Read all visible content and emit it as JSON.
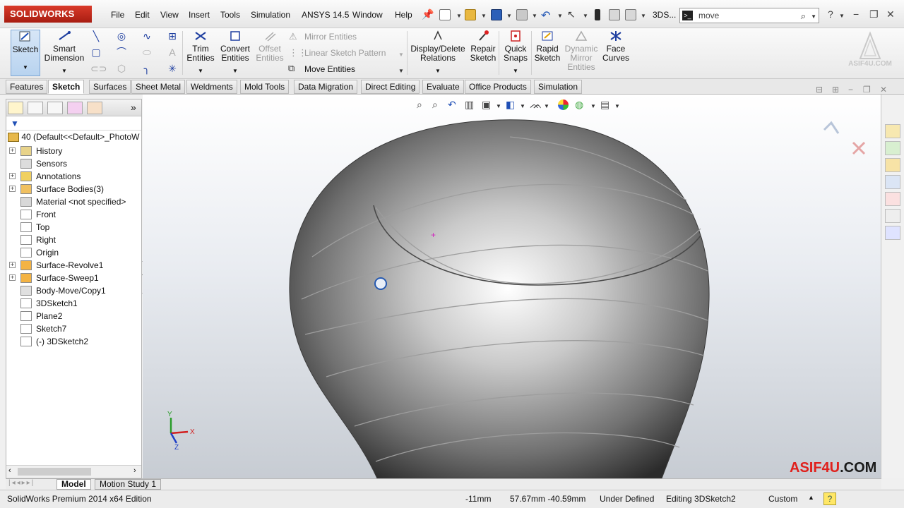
{
  "app": {
    "logo_text": "SOLIDWORKS",
    "menus": [
      "File",
      "Edit",
      "View",
      "Insert",
      "Tools",
      "Simulation",
      "ANSYS 14.5",
      "Window",
      "Help"
    ],
    "doc_name": "3DS...",
    "search": {
      "value": "move"
    }
  },
  "ribbon": {
    "sketch": "Sketch",
    "smart_dimension": [
      "Smart",
      "Dimension"
    ],
    "trim_entities": [
      "Trim",
      "Entities"
    ],
    "convert_entities": [
      "Convert",
      "Entities"
    ],
    "offset_entities": [
      "Offset",
      "Entities"
    ],
    "mirror_entities": "Mirror Entities",
    "linear_sketch_pattern": "Linear Sketch Pattern",
    "move_entities": "Move Entities",
    "display_delete_relations": [
      "Display/Delete",
      "Relations"
    ],
    "repair_sketch": [
      "Repair",
      "Sketch"
    ],
    "quick_snaps": [
      "Quick",
      "Snaps"
    ],
    "rapid_sketch": [
      "Rapid",
      "Sketch"
    ],
    "dynamic_mirror": [
      "Dynamic",
      "Mirror",
      "Entities"
    ],
    "face_curves": [
      "Face",
      "Curves"
    ]
  },
  "brand": {
    "text": "ASIF4U.COM",
    "accent": "#e0201c",
    "secondary": "#1a1a1a"
  },
  "tabs": [
    "Features",
    "Sketch",
    "Surfaces",
    "Sheet Metal",
    "Weldments",
    "Mold Tools",
    "Data Migration",
    "Direct Editing",
    "Evaluate",
    "Office Products",
    "Simulation"
  ],
  "active_tab": "Sketch",
  "feature_tree": {
    "root": "40  (Default<<Default>_PhotoW",
    "items": [
      {
        "label": "History",
        "expandable": true,
        "icon": "history-icon"
      },
      {
        "label": "Sensors",
        "expandable": false,
        "icon": "sensors-icon"
      },
      {
        "label": "Annotations",
        "expandable": true,
        "icon": "annotations-icon"
      },
      {
        "label": "Surface Bodies(3)",
        "expandable": true,
        "icon": "surface-bodies-icon"
      },
      {
        "label": "Material <not specified>",
        "expandable": false,
        "icon": "material-icon"
      },
      {
        "label": "Front",
        "expandable": false,
        "icon": "plane-icon"
      },
      {
        "label": "Top",
        "expandable": false,
        "icon": "plane-icon"
      },
      {
        "label": "Right",
        "expandable": false,
        "icon": "plane-icon"
      },
      {
        "label": "Origin",
        "expandable": false,
        "icon": "origin-icon"
      },
      {
        "label": "Surface-Revolve1",
        "expandable": true,
        "icon": "surface-revolve-icon"
      },
      {
        "label": "Surface-Sweep1",
        "expandable": true,
        "icon": "surface-sweep-icon"
      },
      {
        "label": "Body-Move/Copy1",
        "expandable": false,
        "icon": "body-move-icon"
      },
      {
        "label": "3DSketch1",
        "expandable": false,
        "icon": "3dsketch-icon"
      },
      {
        "label": "Plane2",
        "expandable": false,
        "icon": "plane-icon"
      },
      {
        "label": "Sketch7",
        "expandable": false,
        "icon": "sketch-icon"
      },
      {
        "label": "(-) 3DSketch2",
        "expandable": false,
        "icon": "3dsketch-icon"
      }
    ]
  },
  "bottom_tabs": [
    "Model",
    "Motion Study 1"
  ],
  "status": {
    "edition": "SolidWorks Premium 2014 x64 Edition",
    "z": "-11mm",
    "xy": "57.67mm -40.59mm",
    "state": "Under Defined",
    "editing": "Editing 3DSketch2",
    "units": "Custom"
  },
  "triad": {
    "x": "X",
    "y": "Y",
    "z": "Z"
  }
}
